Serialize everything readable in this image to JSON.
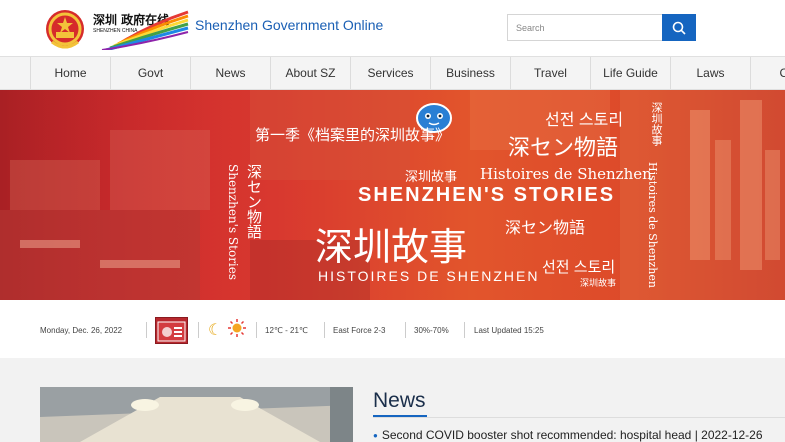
{
  "header": {
    "logo_cn": "深圳 政府在线",
    "logo_en": "SHENZHEN CHINA",
    "site_title": "Shenzhen Government Online",
    "search_placeholder": "Search",
    "search_icon": "search-icon"
  },
  "nav": {
    "items": [
      {
        "label": "Home"
      },
      {
        "label": "Govt"
      },
      {
        "label": "News"
      },
      {
        "label": "About SZ"
      },
      {
        "label": "Services"
      },
      {
        "label": "Business"
      },
      {
        "label": "Travel"
      },
      {
        "label": "Life Guide"
      },
      {
        "label": "Laws"
      },
      {
        "label": "Con"
      }
    ]
  },
  "banner": {
    "season": "第一季《档案里的深圳故事》",
    "ko_1": "선전 스토리",
    "ja_1": "深セン物語",
    "cn_small_1": "深圳故事",
    "fr_1": "Histoires de Shenzhen",
    "en_title": "SHENZHEN'S STORIES",
    "cn_big": "深圳故事",
    "ja_2": "深セン物語",
    "fr_2": "HISTOIRES DE SHENZHEN",
    "ko_2": "선전 스토리",
    "cn_small_2": "深圳故事",
    "v_ja": "深セン物語",
    "v_en": "Shenzhen's Stories",
    "v_cn": "深圳故事",
    "v_fr": "Histoires de Shenzhen",
    "colors": {
      "primary": "#c8232b",
      "accent": "#e2552c"
    }
  },
  "info": {
    "date": "Monday, Dec. 26, 2022",
    "weather_icons": [
      "crescent-moon-icon",
      "sun-icon"
    ],
    "temperature": "12℃ - 21℃",
    "wind": "East Force 2-3",
    "humidity": "30%-70%",
    "last_updated": "Last Updated 15:25"
  },
  "news": {
    "heading": "News",
    "items": [
      {
        "text": "Second COVID booster shot recommended: hospital head | 2022-12-26"
      }
    ]
  },
  "colors": {
    "brand_blue": "#1565c0",
    "title_blue": "#1a5fb4",
    "nav_bg": "#f4f4f4"
  }
}
